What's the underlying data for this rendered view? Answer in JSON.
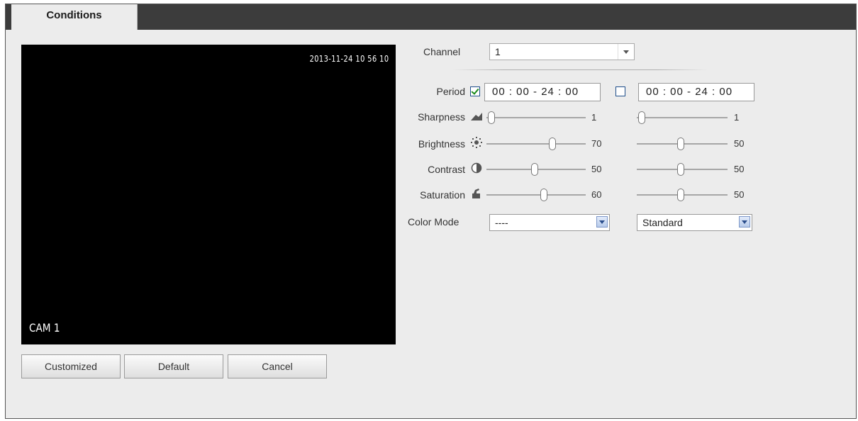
{
  "tab": {
    "label": "Conditions"
  },
  "video": {
    "timestamp": "2013-11-24 10 56 10",
    "camera_label": "CAM 1"
  },
  "buttons": {
    "customized": "Customized",
    "default": "Default",
    "cancel": "Cancel"
  },
  "channel": {
    "label": "Channel",
    "value": "1"
  },
  "period": {
    "label": "Period",
    "p1": {
      "checked": true,
      "value": "00 : 00 - 24 : 00"
    },
    "p2": {
      "checked": false,
      "value": "00 : 00 - 24 : 00"
    }
  },
  "settings": [
    {
      "key": "sharpness",
      "label": "Sharpness",
      "icon": "sharpness-icon",
      "p1": 1,
      "p2": 1,
      "max": 15
    },
    {
      "key": "brightness",
      "label": "Brightness",
      "icon": "brightness-icon",
      "p1": 70,
      "p2": 50,
      "max": 100
    },
    {
      "key": "contrast",
      "label": "Contrast",
      "icon": "contrast-icon",
      "p1": 50,
      "p2": 50,
      "max": 100
    },
    {
      "key": "saturation",
      "label": "Saturation",
      "icon": "saturation-icon",
      "p1": 60,
      "p2": 50,
      "max": 100
    }
  ],
  "color_mode": {
    "label": "Color Mode",
    "p1": "----",
    "p2": "Standard"
  },
  "colors": {
    "tab_bar": "#3c3c3c",
    "panel": "#ececec",
    "check_tick": "#1a8a1a",
    "checkbox_border": "#1f4e8a"
  }
}
